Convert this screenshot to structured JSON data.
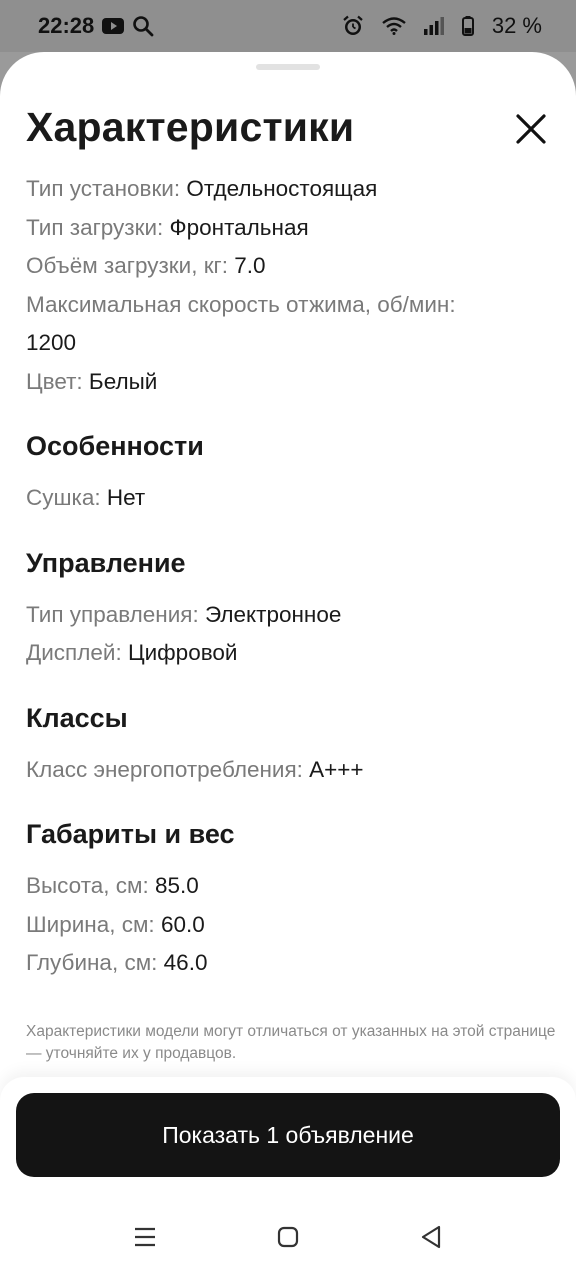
{
  "status_bar": {
    "time": "22:28",
    "icons_left": [
      "youtube-icon",
      "search-icon"
    ],
    "icons_right": [
      "alarm-icon",
      "wifi-icon",
      "signal-icon",
      "battery-icon"
    ],
    "battery": "32 %"
  },
  "sheet": {
    "title": "Характеристики",
    "general": [
      {
        "label": "Тип установки: ",
        "value": "Отдельностоящая"
      },
      {
        "label": "Тип загрузки: ",
        "value": "Фронтальная"
      },
      {
        "label": "Объём загрузки, кг: ",
        "value": "7.0"
      },
      {
        "label": "Максимальная скорость отжима, об/мин: ",
        "value": "1200"
      },
      {
        "label": "Цвет: ",
        "value": "Белый"
      }
    ],
    "sections": [
      {
        "title": "Особенности",
        "rows": [
          {
            "label": "Сушка: ",
            "value": "Нет"
          }
        ]
      },
      {
        "title": "Управление",
        "rows": [
          {
            "label": "Тип управления: ",
            "value": "Электронное"
          },
          {
            "label": "Дисплей: ",
            "value": "Цифровой"
          }
        ]
      },
      {
        "title": "Классы",
        "rows": [
          {
            "label": "Класс энергопотребления: ",
            "value": "A+++"
          }
        ]
      },
      {
        "title": "Габариты и вес",
        "rows": [
          {
            "label": "Высота, см: ",
            "value": "85.0"
          },
          {
            "label": "Ширина, см: ",
            "value": "60.0"
          },
          {
            "label": "Глубина, см: ",
            "value": "46.0"
          }
        ]
      }
    ],
    "note": "Характеристики модели могут отличаться от указанных на этой странице — уточняйте их у продавцов."
  },
  "cta": {
    "label": "Показать 1 объявление"
  },
  "nav": [
    "menu-icon",
    "home-icon",
    "back-icon"
  ]
}
